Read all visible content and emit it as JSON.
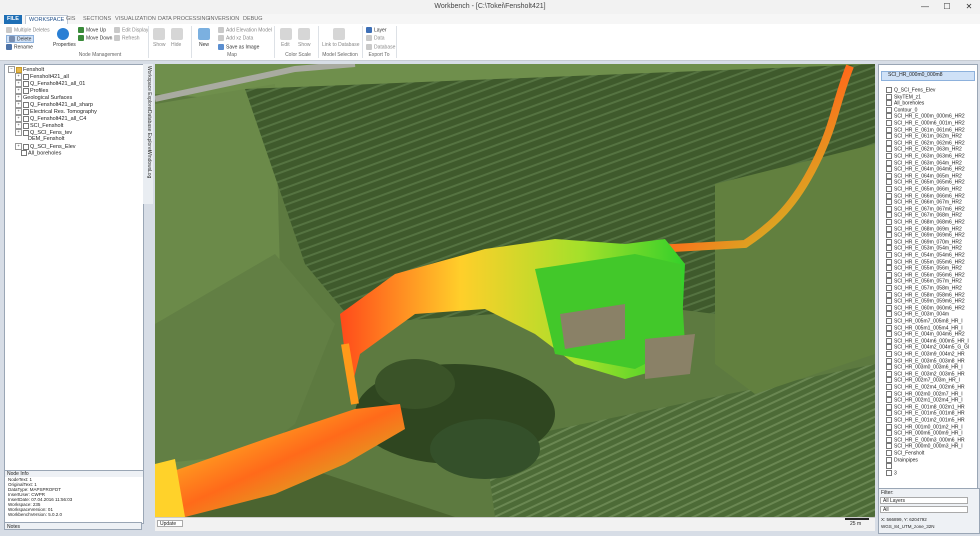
{
  "window": {
    "title": "Workbench - [C:\\Tokei\\Fensholt421]",
    "min": "—",
    "max": "☐",
    "close": "✕"
  },
  "tabs": [
    "FILE",
    "WORKSPACE",
    "GIS",
    "SECTIONS",
    "VISUALIZATION",
    "DATA PROCESSING",
    "INVERSION",
    "DEBUG"
  ],
  "ribbon": {
    "multiple_deletes": "Multiple Deletes",
    "delete": "Delete",
    "rename": "Rename",
    "properties": "Properties",
    "move_up": "Move Up",
    "move_down": "Move Down",
    "edit_display": "Edit Display",
    "refresh": "Refresh",
    "show": "Show",
    "hide": "Hide",
    "new": "New",
    "add_elevation": "Add Elevation Model",
    "add_xz_data": "Add xz Data",
    "save_as_image": "Save as Image",
    "edit": "Edit",
    "show2": "Show",
    "link_database": "Link to Database",
    "layer": "Layer",
    "data": "Data",
    "database": "Database",
    "groups": {
      "node": "Node Management",
      "map": "Map",
      "color": "Color Scale",
      "model": "Model Selection",
      "export": "Export To"
    }
  },
  "tree": {
    "root": "Fensholt",
    "items": [
      "Fensholt421_all",
      "Q_Fensholt421_all_01",
      "Profiles",
      "Geological Surfaces",
      "Q_Fensholt421_all_sharp",
      "Electrical Res. Tomography",
      "Q_Fensholt421_all_C4",
      "SCI_Fensholt",
      "Q_SCI_Fens_tev",
      "DEM_Fensholt",
      "Q_SCI_Fens_Elev",
      "All_boreholes"
    ]
  },
  "side_tabs": [
    "Workspace Explorer",
    "Database Explorer",
    "Windows",
    "Log"
  ],
  "node_info": {
    "title": "Node Info",
    "lines": [
      "NodeText:  1",
      "OriginalText:  1",
      "DataType:  MAPSPROFDT",
      "InsertUser:  CWPR",
      "InsertDate:  07.04.2016 11:56:03",
      "Workspace:  235",
      "WorkspaceVersion:  01",
      "WorkbenchVersion:  5.0.2.0"
    ]
  },
  "notes": "Notes",
  "map": {
    "update_label": "Update",
    "scale_label": "25 m",
    "coords": "X: 566899, Y: 6204792",
    "crs": "WGS_84_UTM_zone_32N"
  },
  "layers": {
    "top": "SCI_HR_000m0_000m8",
    "items": [
      "Q_SCI_Fens_Elev",
      "SkyTEM_z1",
      "All_boreholes",
      "Contour_0",
      "SCI_HR_E_000m_000m6_HR2",
      "SCI_HR_E_000m6_001m_HR2",
      "SCI_HR_E_061m_061m6_HR2",
      "SCI_HR_E_061m_062m_HR2",
      "SCI_HR_E_062m_062m6_HR2",
      "SCI_HR_E_062m_063m_HR2",
      "SCI_HR_E_063m_063m6_HR2",
      "SCI_HR_E_063m_064m_HR2",
      "SCI_HR_E_064m_064m6_HR2",
      "SCI_HR_E_064m_065m_HR2",
      "SCI_HR_E_065m_065m6_HR2",
      "SCI_HR_E_065m_066m_HR2",
      "SCI_HR_E_066m_066m6_HR2",
      "SCI_HR_E_066m_067m_HR2",
      "SCI_HR_E_067m_067m6_HR2",
      "SCI_HR_E_067m_068m_HR2",
      "SCI_HR_E_068m_068m6_HR2",
      "SCI_HR_E_068m_069m_HR2",
      "SCI_HR_E_069m_069m6_HR2",
      "SCI_HR_E_069m_070m_HR2",
      "SCI_HR_E_053m_054m_HR2",
      "SCI_HR_E_054m_054m6_HR2",
      "SCI_HR_E_055m_055m6_HR2",
      "SCI_HR_E_055m_056m_HR2",
      "SCI_HR_E_056m_056m6_HR2",
      "SCI_HR_E_056m_057m_HR2",
      "SCI_HR_E_057m_058m_HR2",
      "SCI_HR_E_058m_058m6_HR2",
      "SCI_HR_E_059m_059m6_HR2",
      "SCI_HR_E_060m_060m6_HR2",
      "SCI_HR_E_003m_004m",
      "SCI_HR_005m7_005m8_HR_I",
      "SCI_HR_005m1_005m4_HR_I",
      "SCI_HR_E_004m_004m6_HR2",
      "SCI_HR_E_004m6_000m5_HR_I",
      "SCI_HR_E_004m2_004m5_G_GI",
      "SCI_HR_E_003m9_004m2_HR",
      "SCI_HR_E_003m5_003m8_HR",
      "SCI_HR_003m0_003m6_HR_I",
      "SCI_HR_E_003m2_003m5_HR",
      "SCI_HR_002m7_003m_HR_I",
      "SCI_HR_E_002m4_002m6_HR",
      "SCI_HR_002m0_002m7_HR_I",
      "SCI_HR_002m1_002m4_HR_I",
      "SCI_HR_E_001m8_002m1_HR",
      "SCI_HR_E_001m5_001m8_HR",
      "SCI_HR_E_001m2_001m5_HR",
      "SCI_HR_001m0_001m2_HR_I",
      "SCI_HR_000m6_000m9_HR_I",
      "SCI_HR_E_000m3_000m6_HR",
      "SCI_HR_000m0_000m3_HR_I",
      "SCI_Fensholt",
      "Drainpipes",
      "",
      "3"
    ]
  },
  "filter": {
    "label": "Filter:",
    "value1": "All Layers",
    "value2": "All"
  },
  "colors": {
    "accent": "#1f6fb5",
    "selected": "#cfe1f7"
  }
}
